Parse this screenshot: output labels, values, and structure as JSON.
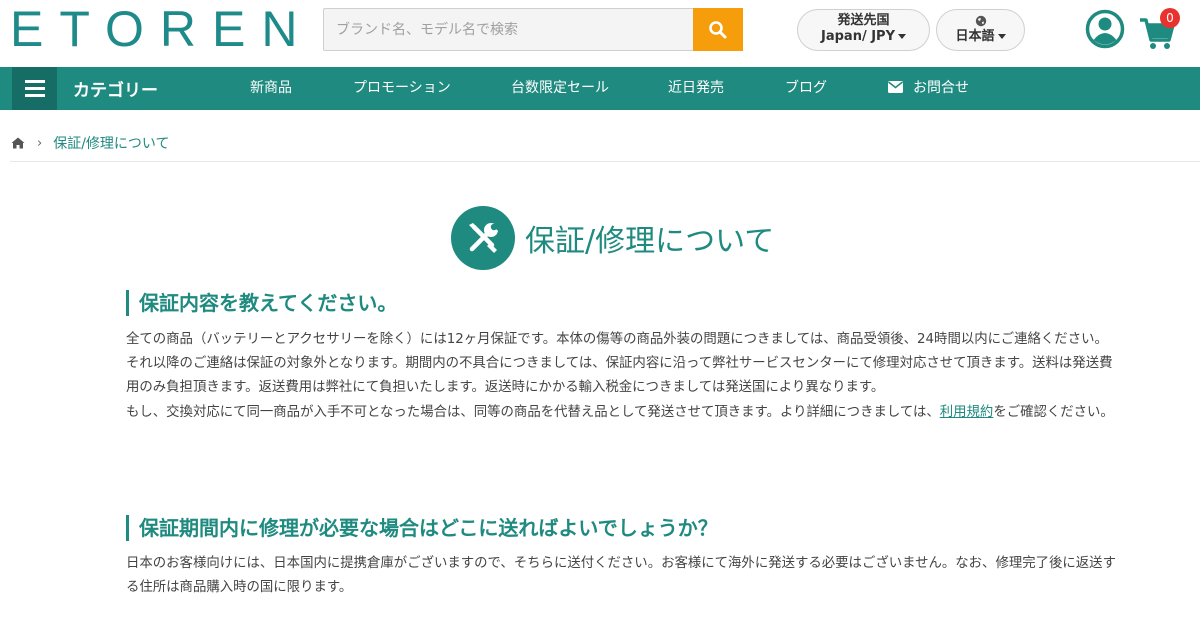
{
  "header": {
    "logo": "ETOREN",
    "search_placeholder": "ブランド名、モデル名で検索",
    "shipping": {
      "label": "発送先国",
      "value": "Japan/ JPY"
    },
    "language": {
      "value": "日本語"
    },
    "cart_count": "0",
    "brand_color": "#1f8a80",
    "search_button_color": "#f59d0b"
  },
  "nav": {
    "category_label": "カテゴリー",
    "items": [
      "新商品",
      "プロモーション",
      "台数限定セール",
      "近日発売",
      "ブログ",
      "お問合せ"
    ]
  },
  "breadcrumb": {
    "current": "保証/修理について"
  },
  "page": {
    "title": "保証/修理について",
    "sections": [
      {
        "heading": "保証内容を教えてください。",
        "para1": "全ての商品（バッテリーとアクセサリーを除く）には12ヶ月保証です。本体の傷等の商品外装の問題につきましては、商品受領後、24時間以内にご連絡ください。 それ以降のご連絡は保証の対象外となります。期間内の不具合につきましては、保証内容に沿って弊社サービスセンターにて修理対応させて頂きます。送料は発送費用のみ負担頂きます。返送費用は弊社にて負担いたします。返送時にかかる輸入税金につきましては発送国により異なります。",
        "para2_before": "もし、交換対応にて同一商品が入手不可となった場合は、同等の商品を代替え品として発送させて頂きます。より詳細につきましては、",
        "para2_link": "利用規約",
        "para2_after": "をご確認ください。"
      },
      {
        "heading": "保証期間内に修理が必要な場合はどこに送ればよいでしょうか？",
        "para1": "日本のお客様向けには、日本国内に提携倉庫がございますので、そちらに送付ください。お客様にて海外に発送する必要はございません。なお、修理完了後に返送する住所は商品購入時の国に限ります。"
      }
    ]
  }
}
